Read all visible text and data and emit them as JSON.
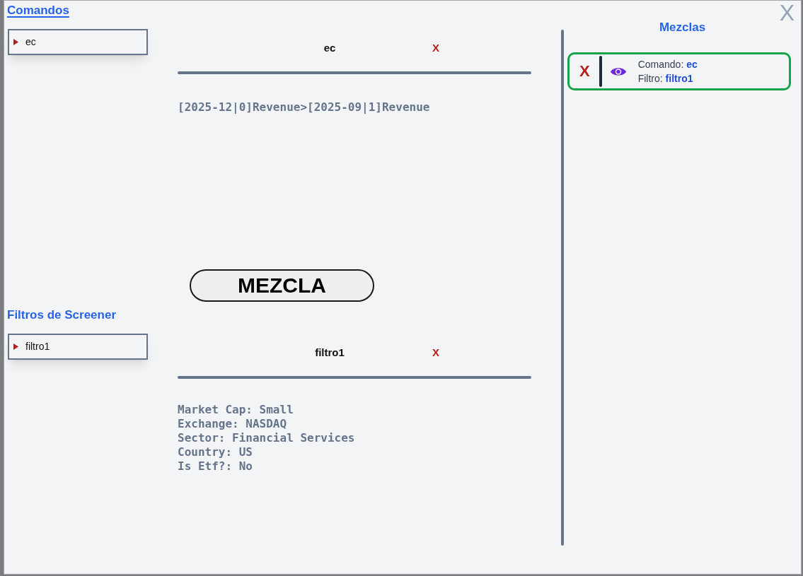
{
  "dialog": {
    "close": "X"
  },
  "sidebar": {
    "sections": [
      {
        "title": "Comandos",
        "selected": true,
        "items": [
          {
            "label": "ec"
          }
        ]
      },
      {
        "title": "Filtros de Screener",
        "selected": false,
        "items": [
          {
            "label": "filtro1"
          }
        ]
      }
    ]
  },
  "editor": {
    "panels": [
      {
        "name": "ec",
        "remove": "X",
        "lines": [
          "[2025-12|0]Revenue>[2025-09|1]Revenue"
        ]
      },
      {
        "name": "filtro1",
        "remove": "X",
        "lines": [
          "Market Cap: Small",
          "Exchange: NASDAQ",
          "Sector: Financial Services",
          "Country: US",
          "Is Etf?: No"
        ]
      }
    ],
    "merge_button": "MEZCLA"
  },
  "mixes": {
    "title": "Mezclas",
    "items": [
      {
        "remove": "X",
        "command": "Comando: **ec**",
        "filter": "Filtro: **filtro1**"
      }
    ]
  }
}
